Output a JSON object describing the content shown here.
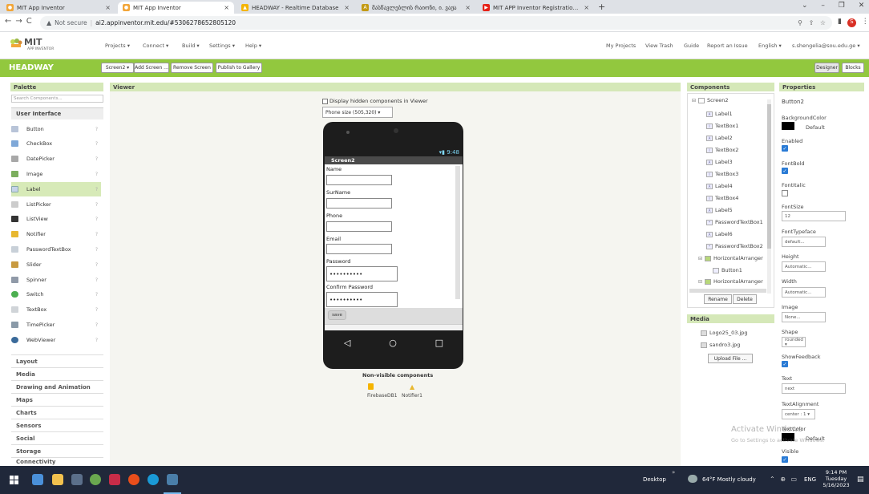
{
  "browser": {
    "tabs": [
      {
        "label": "MIT App Inventor",
        "active": false
      },
      {
        "label": "MIT App Inventor",
        "active": true
      },
      {
        "label": "HEADWAY - Realtime Database",
        "active": false
      },
      {
        "label": "მასწავლებლის რაიონი, ი. ვაჟა",
        "active": false
      },
      {
        "label": "MIT APP Inventor Registration a",
        "active": false
      }
    ],
    "new_tab": "+",
    "not_secure": "Not secure",
    "url": "ai2.appinventor.mit.edu/#5306278652805120"
  },
  "appinventor": {
    "logo_title": "MIT",
    "logo_sub": "APP INVENTOR",
    "menu": [
      "Projects ▾",
      "Connect ▾",
      "Build ▾",
      "Settings ▾",
      "Help ▾"
    ],
    "right_menu": [
      "My Projects",
      "View Trash",
      "Guide",
      "Report an Issue",
      "English ▾",
      "s.shengelia@sou.edu.ge ▾"
    ],
    "project_name": "HEADWAY",
    "screen_btn": "Screen2 ▾",
    "add_screen": "Add Screen ...",
    "remove_screen": "Remove Screen",
    "publish": "Publish to Gallery",
    "designer": "Designer",
    "blocks": "Blocks"
  },
  "palette": {
    "title": "Palette",
    "search_placeholder": "Search Components...",
    "section": "User Interface",
    "items": [
      "Button",
      "CheckBox",
      "DatePicker",
      "Image",
      "Label",
      "ListPicker",
      "ListView",
      "Notifier",
      "PasswordTextBox",
      "Slider",
      "Spinner",
      "Switch",
      "TextBox",
      "TimePicker",
      "WebViewer"
    ],
    "categories": [
      "Layout",
      "Media",
      "Drawing and Animation",
      "Maps",
      "Charts",
      "Sensors",
      "Social",
      "Storage",
      "Connectivity"
    ]
  },
  "viewer": {
    "title": "Viewer",
    "display_hidden": "Display hidden components in Viewer",
    "phone_size": "Phone size (505,320) ▾",
    "status_time": "9:48",
    "screen_title": "Screen2",
    "fields": [
      {
        "label": "Name",
        "value": ""
      },
      {
        "label": "SurName",
        "value": ""
      },
      {
        "label": "Phone",
        "value": ""
      },
      {
        "label": "Email",
        "value": ""
      },
      {
        "label": "Password",
        "value": "••••••••••"
      },
      {
        "label": "Confirm Password",
        "value": "••••••••••"
      }
    ],
    "save_btn": "save",
    "nonvisible_title": "Non-visible components",
    "nonvisible": [
      "FirebaseDB1",
      "Notifier1"
    ]
  },
  "components": {
    "title": "Components",
    "root": "Screen2",
    "items": [
      "Label1",
      "TextBox1",
      "Label2",
      "TextBox2",
      "Label3",
      "TextBox3",
      "Label4",
      "TextBox4",
      "Label5",
      "PasswordTextBox1",
      "Label6",
      "PasswordTextBox2"
    ],
    "arranger1": "HorizontalArranger",
    "button1": "Button1",
    "arranger2": "HorizontalArranger",
    "rename": "Rename",
    "delete": "Delete"
  },
  "media": {
    "title": "Media",
    "files": [
      "Logo25_03.jpg",
      "sandro3.jpg"
    ],
    "upload": "Upload File ..."
  },
  "properties": {
    "title": "Properties",
    "component": "Button2",
    "bg_label": "BackgroundColor",
    "bg_value": "Default",
    "enabled": "Enabled",
    "fontbold": "FontBold",
    "fontitalic": "FontItalic",
    "fontsize": "FontSize",
    "fontsize_value": "12",
    "typeface": "FontTypeface",
    "typeface_value": "default...",
    "height": "Height",
    "height_value": "Automatic...",
    "width": "Width",
    "width_value": "Automatic...",
    "image": "Image",
    "image_value": "None...",
    "shape": "Shape",
    "shape_value": "rounded ▾",
    "showfeedback": "ShowFeedback",
    "text": "Text",
    "text_value": "next",
    "textalign": "TextAlignment",
    "textalign_value": "center : 1 ▾",
    "textcolor": "TextColor",
    "textcolor_value": "Default",
    "visible": "Visible"
  },
  "watermark": {
    "line1": "Activate Windows",
    "line2": "Go to Settings to activate Windows."
  },
  "taskbar": {
    "desktop": "Desktop",
    "weather": "64°F  Mostly cloudy",
    "lang": "ENG",
    "time": "9:14 PM",
    "day": "Tuesday",
    "date": "5/16/2023"
  },
  "colors": {
    "green": "#92c83e",
    "header_panel": "#d5e8b8",
    "taskbar": "#20283a"
  }
}
